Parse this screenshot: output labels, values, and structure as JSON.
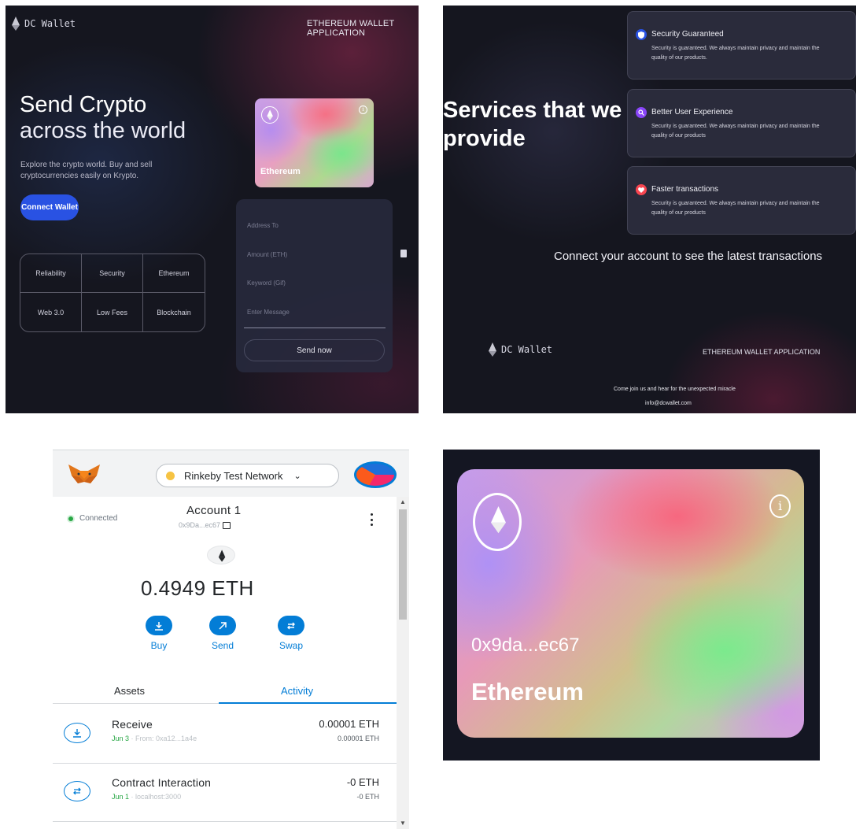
{
  "hero": {
    "logo_text": "DC Wallet",
    "nav_right": "ETHEREUM WALLET APPLICATION",
    "title_line1": "Send Crypto",
    "title_line2": "across the world",
    "subtitle": "Explore the crypto world. Buy and sell cryptocurrencies easily on Krypto.",
    "connect_button": "Connect Wallet",
    "features": [
      "Reliability",
      "Security",
      "Ethereum",
      "Web 3.0",
      "Low Fees",
      "Blockchain"
    ],
    "card_label": "Ethereum",
    "form": {
      "address_placeholder": "Address To",
      "amount_placeholder": "Amount (ETH)",
      "keyword_placeholder": "Keyword (Gif)",
      "message_placeholder": "Enter Message",
      "send_button": "Send now"
    }
  },
  "services": {
    "title_line1": "Services that we",
    "title_line2": "provide",
    "cards": [
      {
        "title": "Security Guaranteed",
        "description": "Security is guaranteed. We always maintain privacy and maintain the quality of our products.",
        "icon": "shield-icon",
        "color": "#2952e3"
      },
      {
        "title": "Better User Experience",
        "description": "Security is guaranteed. We always maintain privacy and maintain the quality of our products",
        "icon": "search-icon",
        "color": "#8945f8"
      },
      {
        "title": "Faster transactions",
        "description": "Security is guaranteed. We always maintain privacy and maintain the quality of our products",
        "icon": "heart-icon",
        "color": "#f84550"
      }
    ],
    "connect_note": "Connect your account to see the latest transactions",
    "footer": {
      "logo_text": "DC Wallet",
      "nav_right": "ETHEREUM WALLET APPLICATION",
      "tagline": "Come join us and hear for the unexpected miracle",
      "email": "info@dcwallet.com"
    }
  },
  "metamask": {
    "network": "Rinkeby Test Network",
    "connected": "Connected",
    "account_name": "Account 1",
    "account_address": "0x9Da...ec67",
    "balance": "0.4949 ETH",
    "actions": [
      {
        "label": "Buy",
        "icon": "download-icon"
      },
      {
        "label": "Send",
        "icon": "arrow-up-right-icon"
      },
      {
        "label": "Swap",
        "icon": "swap-icon"
      }
    ],
    "tabs": {
      "assets": "Assets",
      "activity": "Activity"
    },
    "transactions": [
      {
        "title": "Receive",
        "date": "Jun 3",
        "detail": "From: 0xa12...1a4e",
        "amount": "0.00001 ETH",
        "amount_sub": "0.00001 ETH",
        "icon": "receive-icon"
      },
      {
        "title": "Contract Interaction",
        "date": "Jun 1",
        "detail": "localhost:3000",
        "amount": "-0 ETH",
        "amount_sub": "-0 ETH",
        "icon": "swap-icon"
      }
    ],
    "accent_color": "#037dd6"
  },
  "eth_card": {
    "address": "0x9da...ec67",
    "label": "Ethereum"
  }
}
